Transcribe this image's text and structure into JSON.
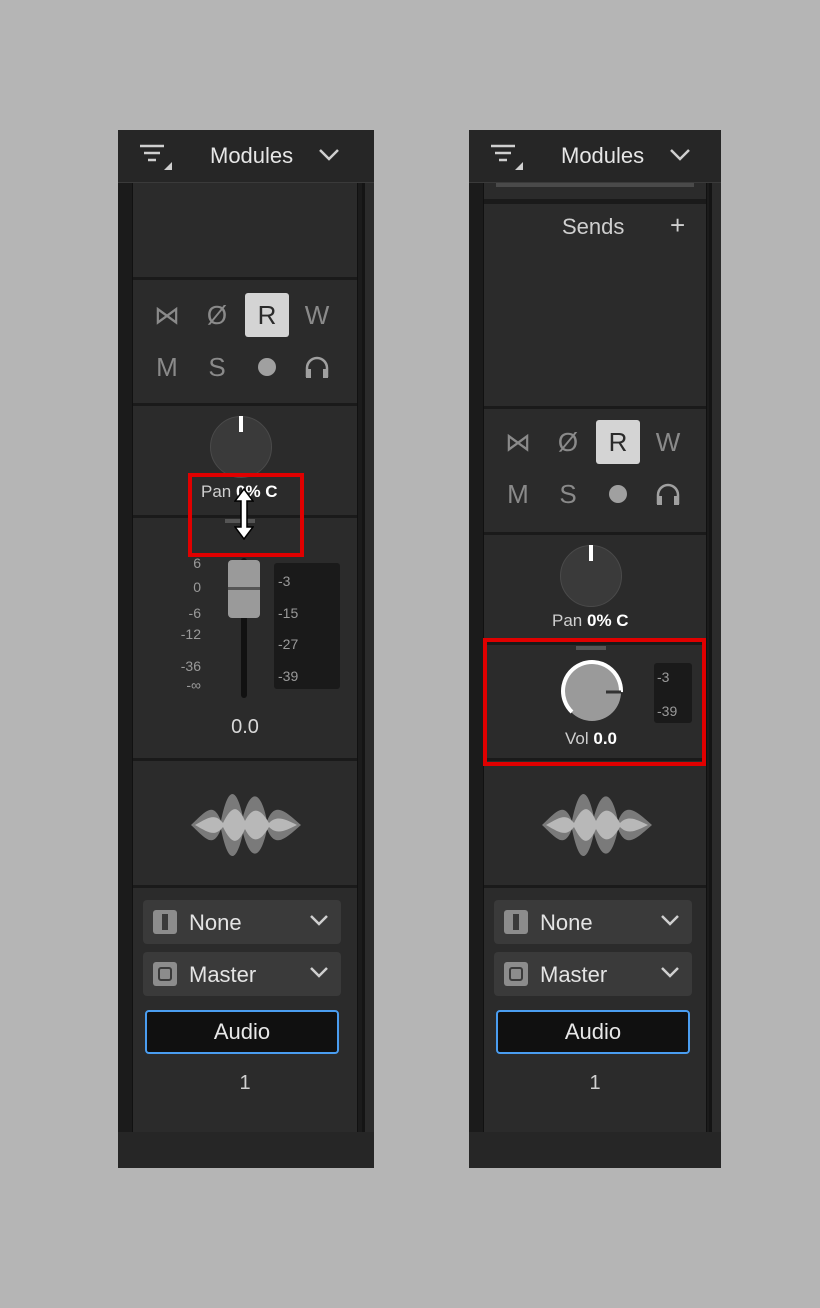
{
  "header": {
    "modules_label": "Modules"
  },
  "buttons": {
    "bypass": "⋈",
    "phase": "Ø",
    "read": "R",
    "write": "W",
    "mute": "M",
    "solo": "S"
  },
  "pan": {
    "label": "Pan",
    "value": "0% C"
  },
  "volume": {
    "label": "Vol",
    "value": "0.0",
    "fader_value": "0.0"
  },
  "fader_scale": [
    "6",
    "0",
    "-6",
    "-12",
    "-36",
    "-∞"
  ],
  "meter_labels_full": [
    "-3",
    "-15",
    "-27",
    "-39"
  ],
  "meter_labels_compact": [
    "-3",
    "-39"
  ],
  "sends": {
    "label": "Sends",
    "add": "+"
  },
  "input_select": {
    "value": "None"
  },
  "output_select": {
    "value": "Master"
  },
  "track": {
    "type_label": "Audio",
    "number": "1"
  },
  "icons": [
    "filter-icon",
    "chevron-down-icon",
    "headphones-icon",
    "record-icon",
    "waveform-icon",
    "input-icon",
    "output-icon",
    "resize-cursor-icon"
  ],
  "colors": {
    "highlight": "#e00000",
    "accent": "#4a9df0",
    "background": "#b5b5b5",
    "panel": "#2b2b2b"
  }
}
